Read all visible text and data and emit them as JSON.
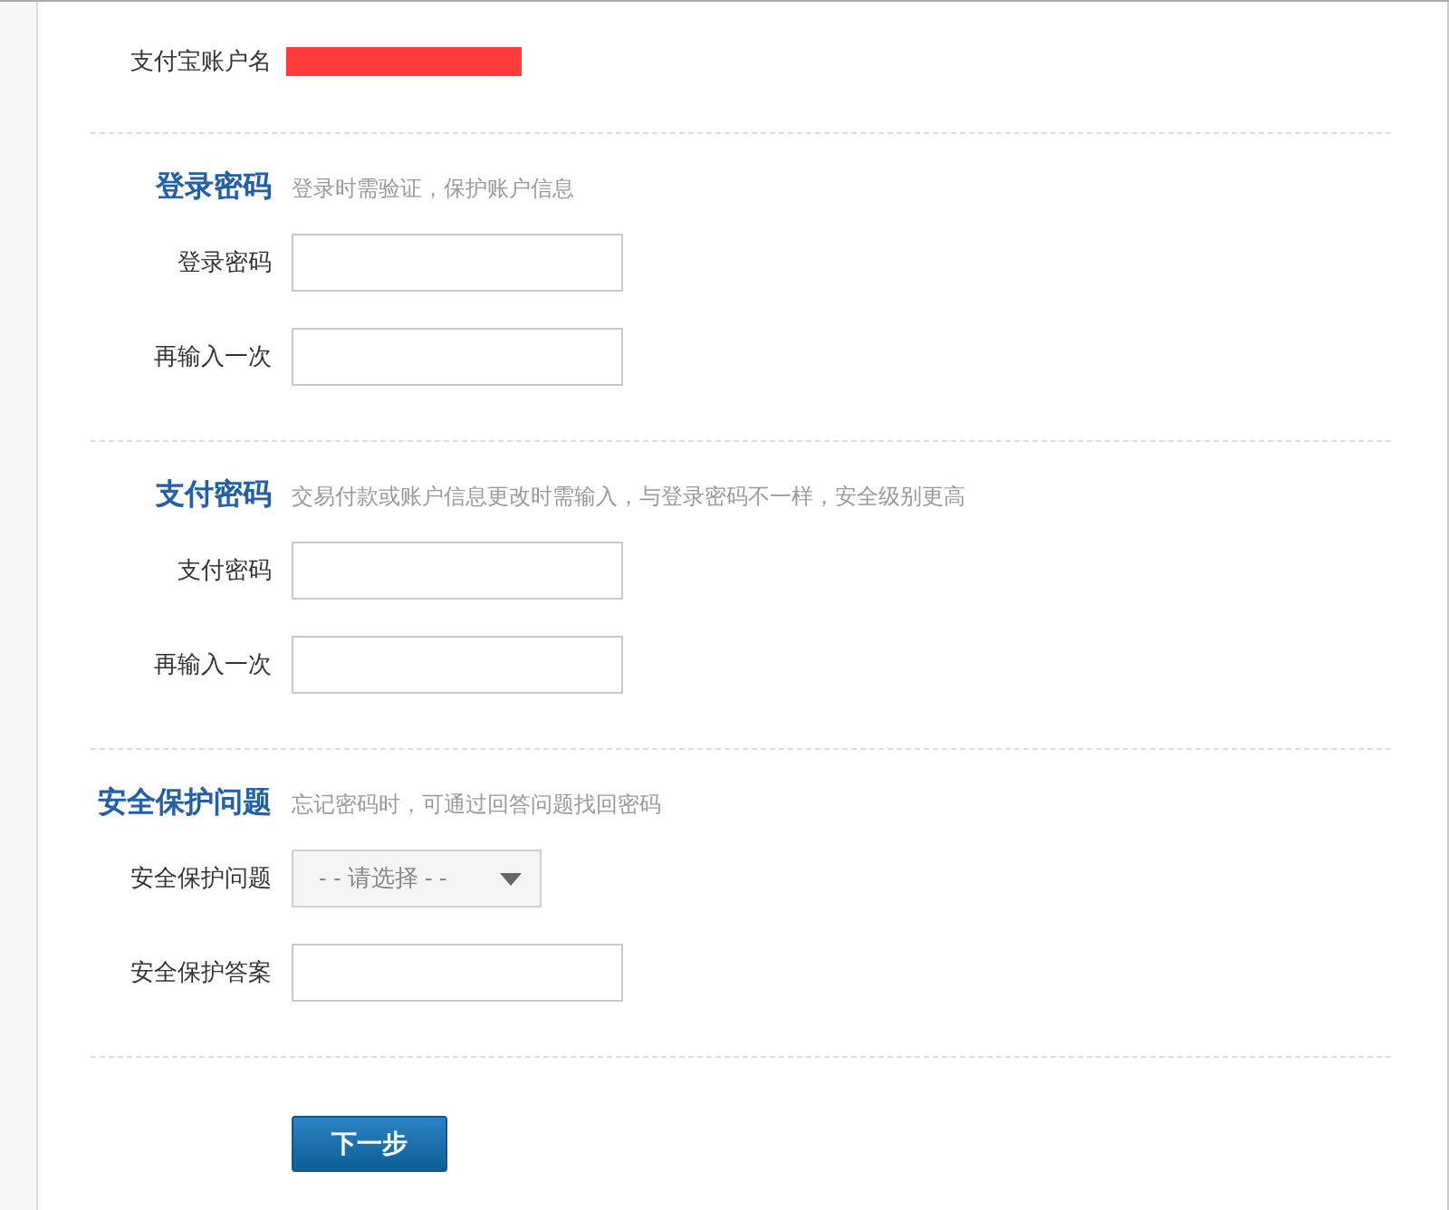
{
  "account": {
    "label": "支付宝账户名",
    "redacted": true
  },
  "sections": [
    {
      "title": "登录密码",
      "hint": "登录时需验证，保护账户信息",
      "fields": [
        {
          "kind": "text",
          "label": "登录密码"
        },
        {
          "kind": "text",
          "label": "再输入一次"
        }
      ]
    },
    {
      "title": "支付密码",
      "hint": "交易付款或账户信息更改时需输入，与登录密码不一样，安全级别更高",
      "fields": [
        {
          "kind": "text",
          "label": "支付密码"
        },
        {
          "kind": "text",
          "label": "再输入一次"
        }
      ]
    },
    {
      "title": "安全保护问题",
      "hint": "忘记密码时，可通过回答问题找回密码",
      "fields": [
        {
          "kind": "select",
          "label": "安全保护问题",
          "value": "- - 请选择 - -"
        },
        {
          "kind": "text",
          "label": "安全保护答案"
        }
      ]
    }
  ],
  "next_button": "下一步"
}
